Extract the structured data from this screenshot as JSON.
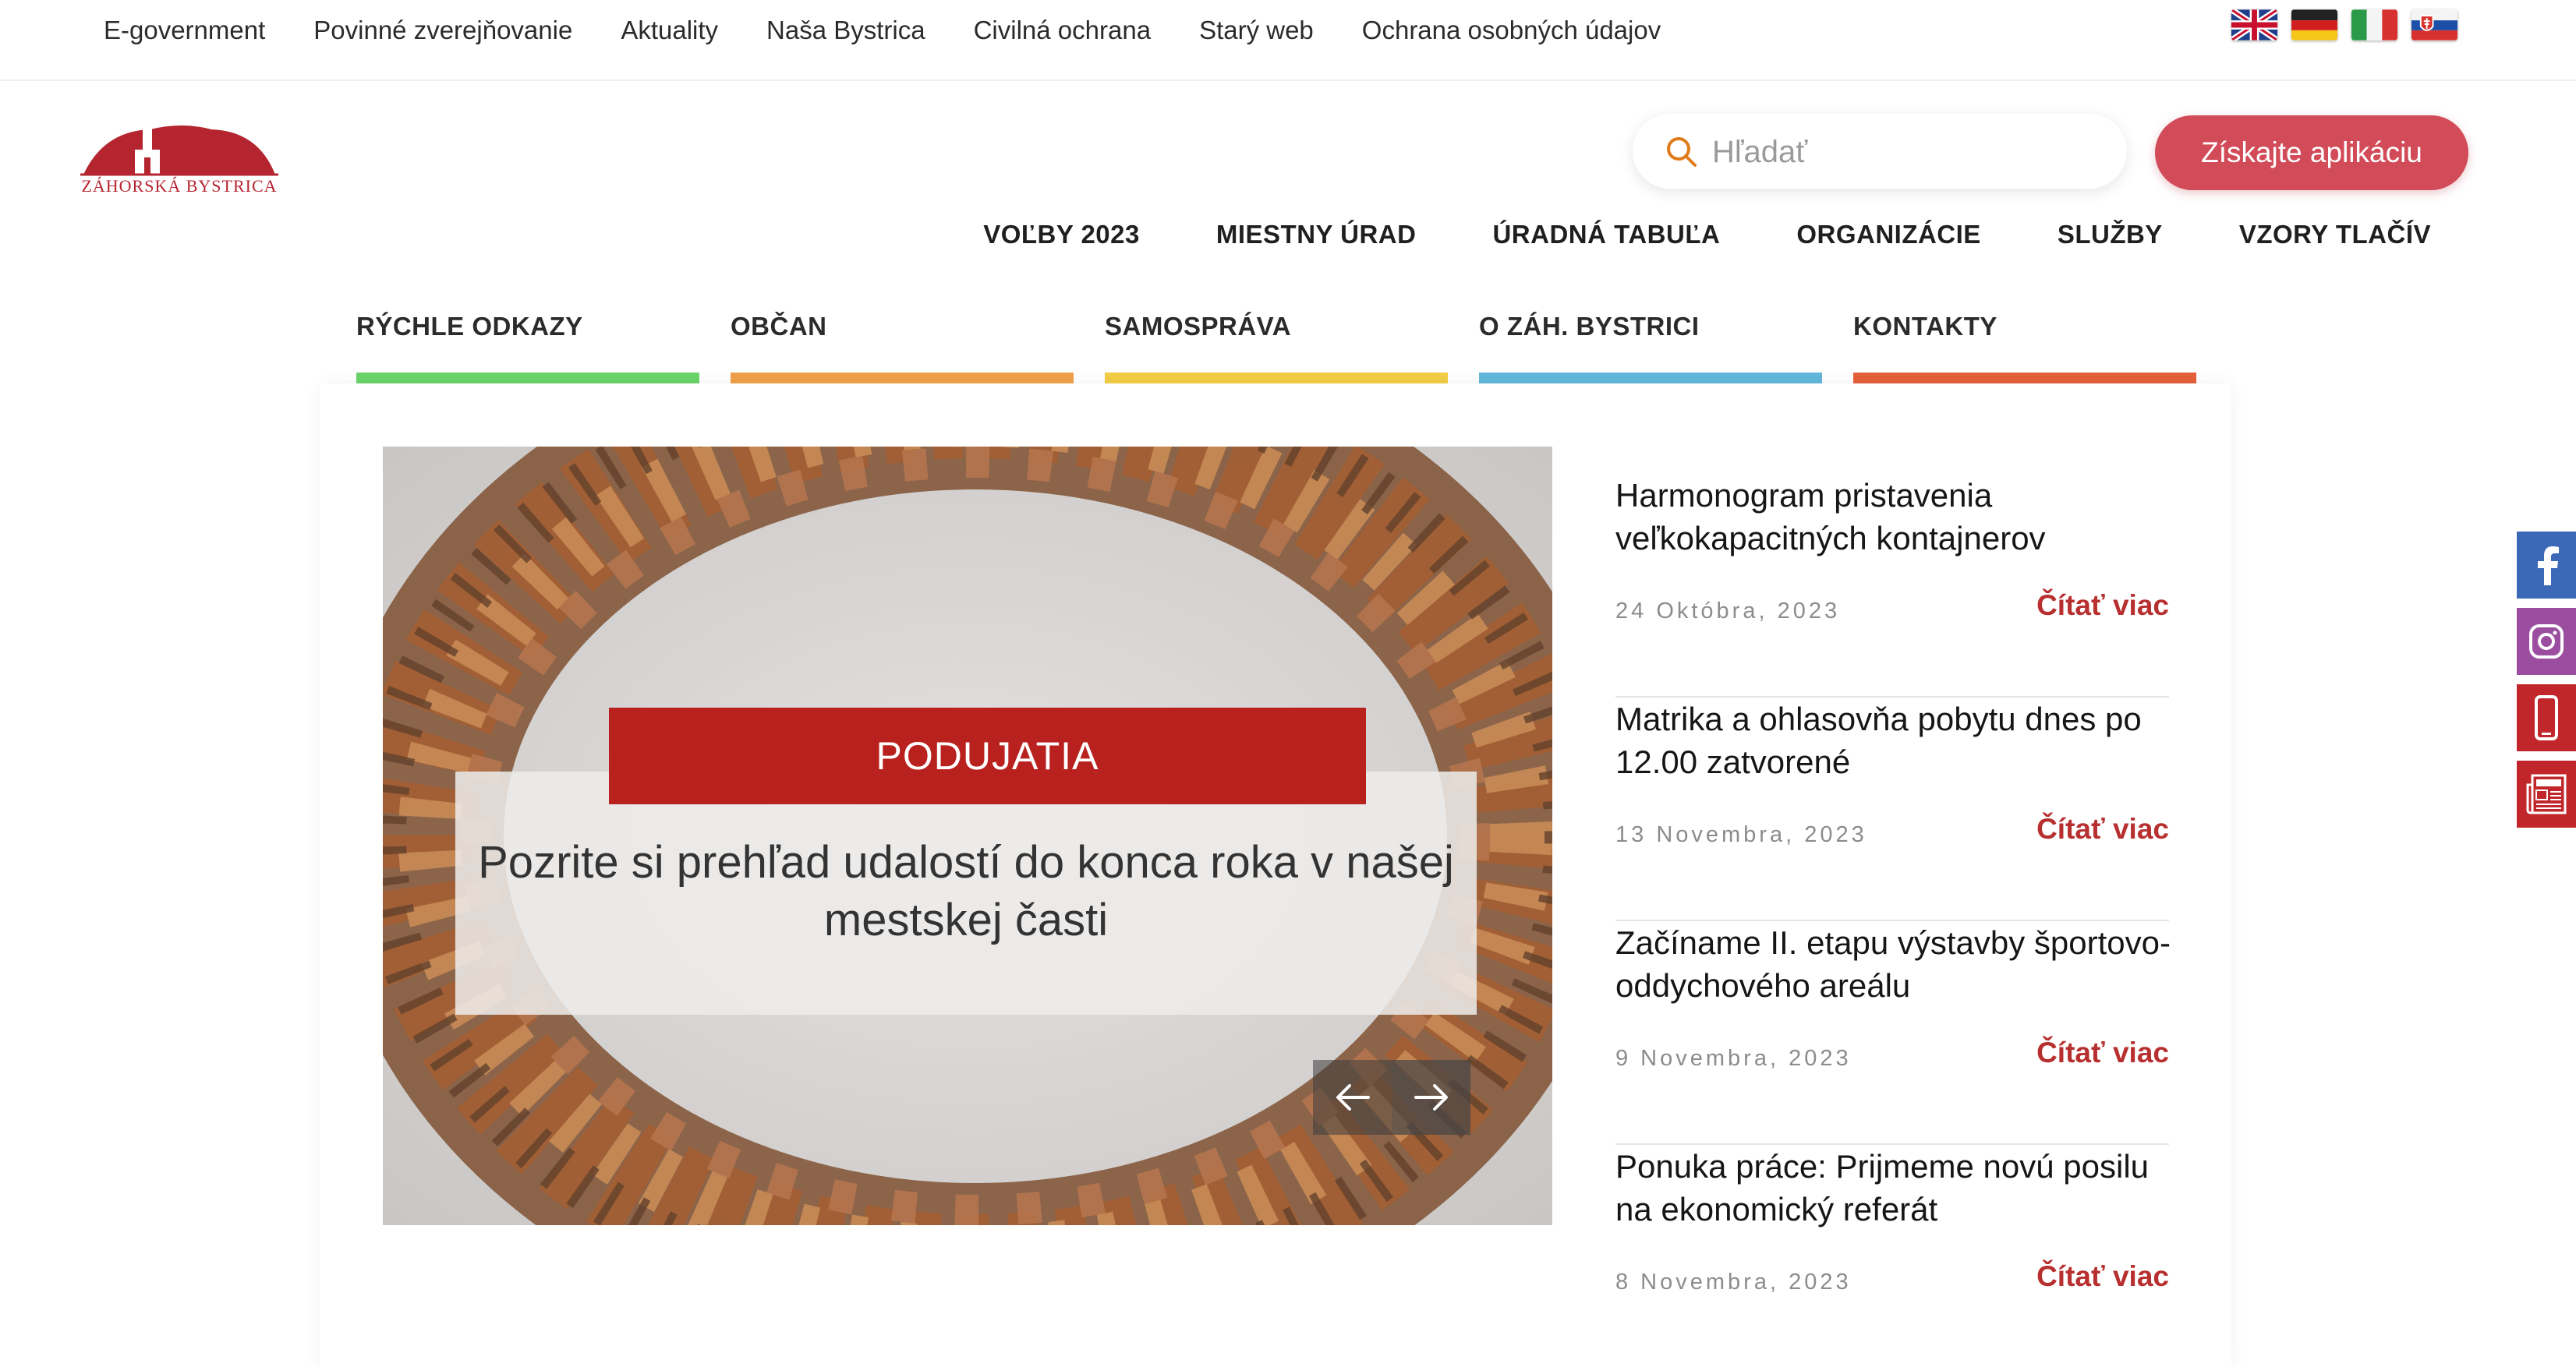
{
  "topbar": {
    "links": [
      "E-government",
      "Povinné zverejňovanie",
      "Aktuality",
      "Naša Bystrica",
      "Civilná ochrana",
      "Starý web",
      "Ochrana osobných údajov"
    ],
    "flags": [
      "flag-uk-icon",
      "flag-de-icon",
      "flag-it-icon",
      "flag-sk-icon"
    ]
  },
  "logo": {
    "text": "Záhorská Bystrica",
    "color": "#b5252f"
  },
  "search": {
    "placeholder": "Hľadať",
    "icon": "search-icon",
    "icon_color": "#e07b1a"
  },
  "app_button": {
    "label": "Získajte aplikáciu",
    "color": "#d24b58"
  },
  "main_nav": [
    "VOĽBY 2023",
    "MIESTNY ÚRAD",
    "ÚRADNÁ TABUĽA",
    "ORGANIZÁCIE",
    "SLUŽBY",
    "VZORY TLAČÍV"
  ],
  "categories": [
    {
      "label": "RÝCHLE ODKAZY",
      "color": "#6ad46a"
    },
    {
      "label": "OBČAN",
      "color": "#f0a04a"
    },
    {
      "label": "SAMOSPRÁVA",
      "color": "#f2cd45"
    },
    {
      "label": "O ZÁH. BYSTRICI",
      "color": "#62b8dc"
    },
    {
      "label": "KONTAKTY",
      "color": "#e5603a"
    }
  ],
  "slider": {
    "ribbon": "PODUJATIA",
    "text": "Pozrite si prehľad udalostí do konca roka v našej mestskej časti",
    "prev_icon": "arrow-left-icon",
    "next_icon": "arrow-right-icon"
  },
  "news": [
    {
      "title": "Harmonogram pristavenia veľkokapacitných kontajnerov",
      "date": "24 Októbra, 2023",
      "more": "Čítať viac"
    },
    {
      "title": "Matrika a ohlasovňa pobytu dnes po 12.00 zatvorené",
      "date": "13 Novembra, 2023",
      "more": "Čítať viac"
    },
    {
      "title": "Začíname II. etapu výstavby športovo-oddychového areálu",
      "date": "9 Novembra, 2023",
      "more": "Čítať viac"
    },
    {
      "title": "Ponuka práce: Prijmeme novú posilu na ekonomický referát",
      "date": "8 Novembra, 2023",
      "more": "Čítať viac"
    }
  ],
  "social": [
    {
      "icon": "facebook-icon",
      "color": "#3b69b8"
    },
    {
      "icon": "instagram-icon",
      "color": "#9b4ea0"
    },
    {
      "icon": "phone-icon",
      "color": "#c0262a"
    },
    {
      "icon": "news-icon",
      "color": "#c0262a"
    }
  ]
}
